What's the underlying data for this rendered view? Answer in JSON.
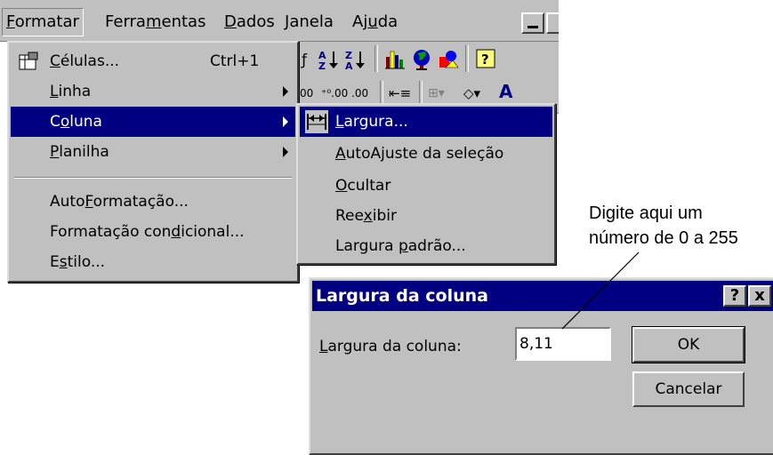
{
  "menubar": {
    "items": [
      {
        "pre": "",
        "key": "F",
        "post": "ormatar"
      },
      {
        "pre": "Ferra",
        "key": "m",
        "post": "entas"
      },
      {
        "pre": "",
        "key": "D",
        "post": "ados"
      },
      {
        "pre": "",
        "key": "J",
        "post": "anela"
      },
      {
        "pre": "Aj",
        "key": "u",
        "post": "da"
      }
    ]
  },
  "toolbar": {
    "sort_asc_icon": "sort-ascending-icon",
    "sort_desc_icon": "sort-descending-icon"
  },
  "formatar_menu": {
    "items": [
      {
        "pre": "",
        "key": "C",
        "post": "élulas...",
        "shortcut": "Ctrl+1"
      },
      {
        "pre": "",
        "key": "L",
        "post": "inha"
      },
      {
        "pre": "C",
        "key": "o",
        "post": "luna"
      },
      {
        "pre": "",
        "key": "P",
        "post": "lanilha"
      },
      {
        "pre": "Auto",
        "key": "F",
        "post": "ormatação..."
      },
      {
        "pre": "Formatação con",
        "key": "d",
        "post": "icional..."
      },
      {
        "pre": "E",
        "key": "s",
        "post": "tilo..."
      }
    ]
  },
  "coluna_submenu": {
    "items": [
      {
        "pre": "",
        "key": "L",
        "post": "argura..."
      },
      {
        "pre": "",
        "key": "A",
        "post": "utoAjuste da seleção"
      },
      {
        "pre": "",
        "key": "O",
        "post": "cultar"
      },
      {
        "pre": "Ree",
        "key": "x",
        "post": "ibir"
      },
      {
        "pre": "Largura ",
        "key": "p",
        "post": "adrão..."
      }
    ]
  },
  "dialog": {
    "title": "Largura da coluna",
    "help": "?",
    "close": "x",
    "label_pre": "",
    "label_key": "L",
    "label_post": "argura da coluna:",
    "value": "8,11",
    "ok": "OK",
    "cancel": "Cancelar"
  },
  "annotation": {
    "line1": "Digite aqui um",
    "line2": "número de 0 a 255"
  }
}
